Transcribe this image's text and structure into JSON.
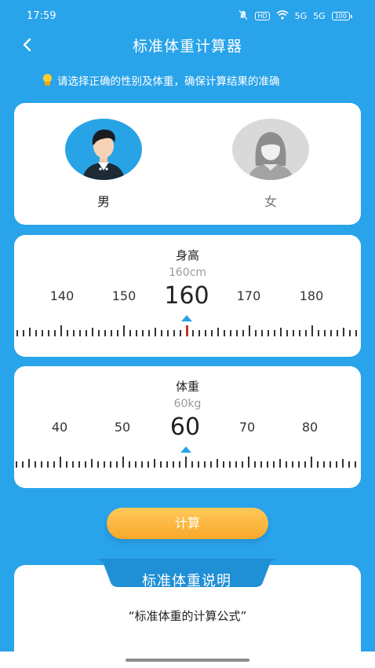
{
  "status": {
    "time": "17:59",
    "hd_badge": "HD",
    "signal1": "5G",
    "signal2": "5G",
    "battery": "100"
  },
  "header": {
    "back_label": "<",
    "title": "标准体重计算器"
  },
  "hint": {
    "text": "请选择正确的性别及体重，确保计算结果的准确"
  },
  "gender": {
    "male_label": "男",
    "female_label": "女",
    "selected": "男"
  },
  "height": {
    "title": "身高",
    "value_display": "160cm",
    "ticks": [
      "140",
      "150",
      "160",
      "170",
      "180"
    ],
    "current": "160"
  },
  "weight": {
    "title": "体重",
    "value_display": "60kg",
    "ticks": [
      "40",
      "50",
      "60",
      "70",
      "80"
    ],
    "current": "60"
  },
  "calculate_label": "计算",
  "explanation": {
    "title": "标准体重说明",
    "text": "“标准体重的计算公式”"
  },
  "colors": {
    "background": "#29a3ea",
    "accent": "#2aa3e6",
    "button": "#f8a82a",
    "pointer_height": "#c0392b"
  },
  "icons": {
    "back": "chevron-left-icon",
    "hint": "lightbulb-icon",
    "mute": "bell-off-icon",
    "wifi": "wifi-icon",
    "battery": "battery-icon"
  }
}
